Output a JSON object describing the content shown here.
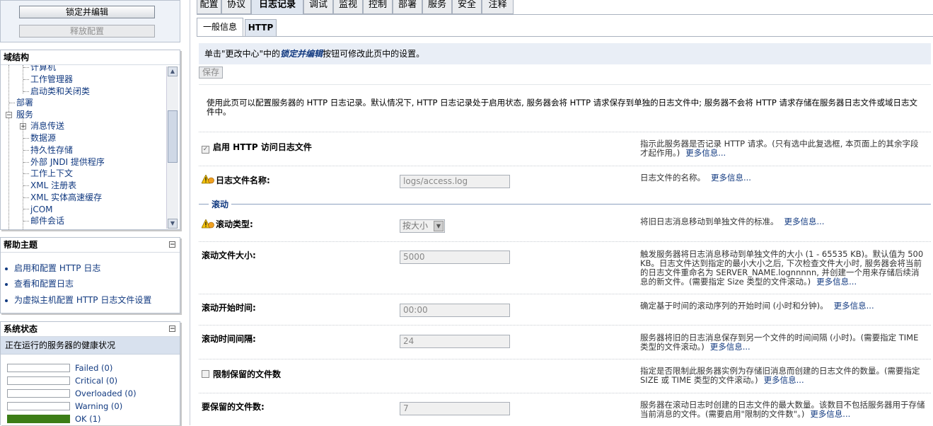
{
  "change_center": {
    "lock_edit_label": "锁定并编辑",
    "release_config_label": "释放配置"
  },
  "domain_structure": {
    "title": "域结构",
    "items": [
      {
        "label": "计算机"
      },
      {
        "label": "工作管理器"
      },
      {
        "label": "启动类和关闭类"
      },
      {
        "label": "部署"
      },
      {
        "label": "服务"
      },
      {
        "label": "消息传送"
      },
      {
        "label": "数据源"
      },
      {
        "label": "持久性存储"
      },
      {
        "label": "外部 JNDI 提供程序"
      },
      {
        "label": "工作上下文"
      },
      {
        "label": "XML 注册表"
      },
      {
        "label": "XML 实体高速缓存"
      },
      {
        "label": "jCOM"
      },
      {
        "label": "邮件会话"
      }
    ]
  },
  "help_topics": {
    "title": "帮助主题",
    "links": [
      {
        "label": "启用和配置 HTTP 日志"
      },
      {
        "label": "查看和配置日志"
      },
      {
        "label": "为虚拟主机配置 HTTP 日志文件设置"
      }
    ]
  },
  "system_status": {
    "title": "系统状态",
    "subtitle": "正在运行的服务器的健康状况",
    "rows": [
      {
        "label": "Failed (0)",
        "fill": 0
      },
      {
        "label": "Critical (0)",
        "fill": 0
      },
      {
        "label": "Overloaded (0)",
        "fill": 0
      },
      {
        "label": "Warning (0)",
        "fill": 0
      },
      {
        "label": "OK (1)",
        "fill": 1
      }
    ]
  },
  "tabs": [
    {
      "label": "配置",
      "active": false
    },
    {
      "label": "协议",
      "active": false
    },
    {
      "label": "日志记录",
      "active": true
    },
    {
      "label": "调试",
      "active": false
    },
    {
      "label": "监视",
      "active": false
    },
    {
      "label": "控制",
      "active": false
    },
    {
      "label": "部署",
      "active": false
    },
    {
      "label": "服务",
      "active": false
    },
    {
      "label": "安全",
      "active": false
    },
    {
      "label": "注释",
      "active": false
    }
  ],
  "subtabs": [
    {
      "label": "一般信息",
      "active": true
    },
    {
      "label": "HTTP",
      "active": false
    }
  ],
  "notice": {
    "prefix": "单击\"更改中心\"中的",
    "link": "锁定并编辑",
    "suffix": "按钮可修改此页中的设置。"
  },
  "save_label": "保存",
  "intro": "使用此页可以配置服务器的 HTTP 日志记录。默认情况下, HTTP 日志记录处于启用状态, 服务器会将 HTTP 请求保存到单独的日志文件中; 服务器不会将 HTTP 请求存储在服务器日志文件或域日志文件中。",
  "more_info": "更多信息...",
  "fields": {
    "enable_http_log": {
      "label": "启用 HTTP 访问日志文件",
      "checked": true,
      "desc": "指示此服务器是否记录 HTTP 请求。(只有选中此复选框, 本页面上的其余字段才起作用。)"
    },
    "log_file_name": {
      "label": "日志文件名称:",
      "value": "logs/access.log",
      "desc": "日志文件的名称。"
    },
    "rotation_section": "滚动",
    "rotation_type": {
      "label": "滚动类型:",
      "value": "按大小",
      "desc": "将旧日志消息移动到单独文件的标准。"
    },
    "rotation_file_size": {
      "label": "滚动文件大小:",
      "value": "5000",
      "desc": "触发服务器将日志消息移动到单独文件的大小 (1 - 65535 KB)。默认值为 500 KB。日志文件达到指定的最小大小之后, 下次检查文件大小时, 服务器会将当前的日志文件重命名为 SERVER_NAME.lognnnnn, 并创建一个用来存储后续消息的新文件。(需要指定 Size 类型的文件滚动。)"
    },
    "rotation_start_time": {
      "label": "滚动开始时间:",
      "value": "00:00",
      "desc": "确定基于时间的滚动序列的开始时间 (小时和分钟)。"
    },
    "rotation_interval": {
      "label": "滚动时间间隔:",
      "value": "24",
      "desc": "服务器将旧的日志消息保存到另一个文件的时间间隔 (小时)。(需要指定 TIME 类型的文件滚动。)"
    },
    "limit_retained_files": {
      "label": "限制保留的文件数",
      "checked": false,
      "desc": "指定是否限制此服务器实例为存储旧消息而创建的日志文件的数量。(需要指定 SIZE 或 TIME 类型的文件滚动。)"
    },
    "files_to_retain": {
      "label": "要保留的文件数:",
      "value": "7",
      "desc": "服务器在滚动日志时创建的日志文件的最大数量。该数目不包括服务器用于存储当前消息的文件。(需要启用\"限制的文件数\"。)"
    }
  },
  "colors": {
    "link": "#123a80",
    "ok_bar": "#3c7d17",
    "notice_bg": "#e9eef6"
  }
}
